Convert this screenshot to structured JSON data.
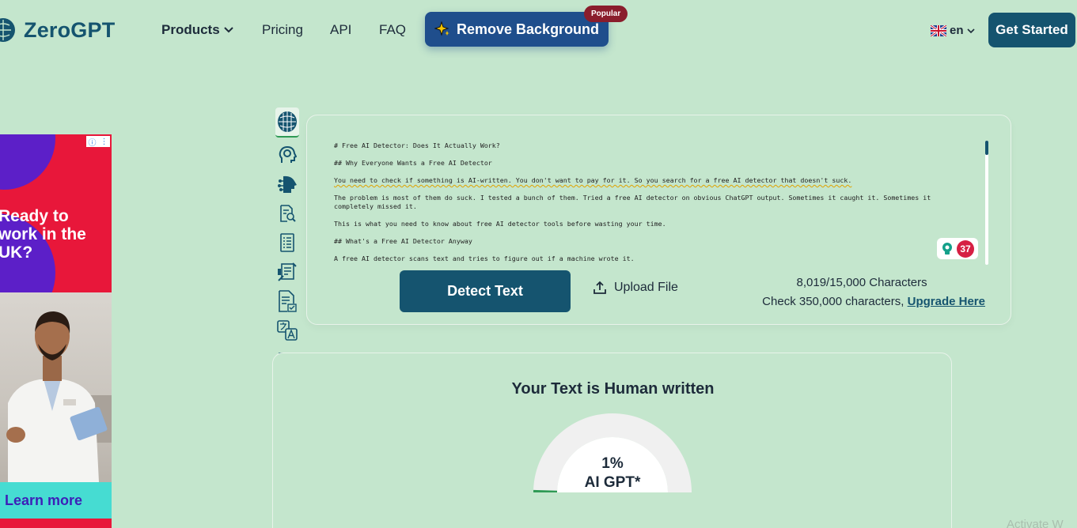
{
  "header": {
    "brand": "ZeroGPT",
    "nav": {
      "products": "Products",
      "pricing": "Pricing",
      "api": "API",
      "faq": "FAQ"
    },
    "remove_background": "Remove Background",
    "popular_badge": "Popular",
    "language": "en",
    "get_started": "Get Started"
  },
  "ad": {
    "headline": "Ready to\nwork in the\nUK?",
    "cta": "Learn more"
  },
  "tools": [
    {
      "icon": "brain-icon"
    },
    {
      "icon": "head-gear-icon"
    },
    {
      "icon": "ai-head-icon"
    },
    {
      "icon": "document-search-icon"
    },
    {
      "icon": "document-list-icon"
    },
    {
      "icon": "document-edit-icon"
    },
    {
      "icon": "document-check-icon"
    },
    {
      "icon": "translate-icon"
    },
    {
      "icon": "word-count-icon"
    }
  ],
  "editor": {
    "lines": [
      "# Free AI Detector: Does It Actually Work?",
      "## Why Everyone Wants a Free AI Detector",
      "You need to check if something is AI-written. You don't want to pay for it. So you search for a free AI detector that doesn't suck.",
      "The problem is most of them do suck. I tested a bunch of them. Tried a free AI detector on obvious ChatGPT output. Sometimes it caught it. Sometimes it completely missed it.",
      "This is what you need to know about free AI detector tools before wasting your time.",
      "## What's a Free AI Detector Anyway",
      "A free AI detector scans text and tries to figure out if a machine wrote it."
    ],
    "issue_count": "37",
    "detect_button": "Detect Text",
    "upload_label": "Upload File",
    "char_count": "8,019/15,000 Characters",
    "upgrade_prefix": "Check 350,000 characters,",
    "upgrade_link": "Upgrade Here"
  },
  "result": {
    "title": "Your Text is Human written",
    "percent": "1%",
    "label": "AI GPT*",
    "ai_fraction": 0.01
  },
  "watermark": "Activate W",
  "colors": {
    "page_bg": "#c4e6cd",
    "brand": "#15546f",
    "remove_bg_button": "#1f4e8c",
    "popular": "#8a1d2c",
    "ad_red": "#e8173a",
    "ad_purple": "#5c1fc8",
    "ad_cta": "#46dcd2"
  }
}
